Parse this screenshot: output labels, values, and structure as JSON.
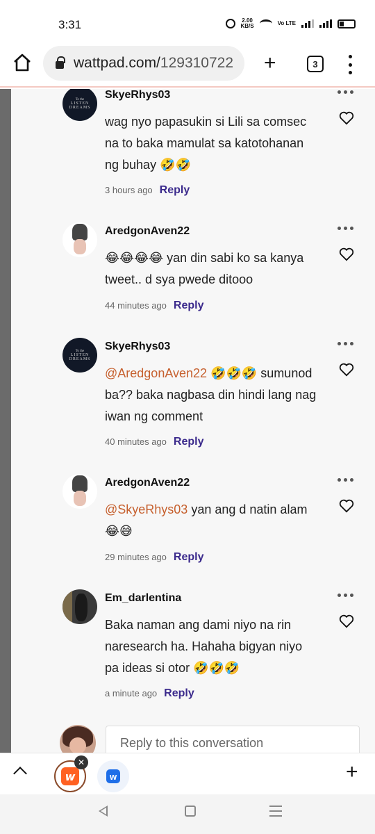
{
  "status_bar": {
    "time": "3:31",
    "net_speed": "2.00",
    "net_unit": "KB/S",
    "volte": "Vo LTE"
  },
  "browser": {
    "url_domain": "wattpad.com/",
    "url_path": "129310722",
    "tab_count": "3"
  },
  "comments": [
    {
      "username": "SkyeRhys03",
      "mention": "",
      "text_lines": [
        "wag nyo papasukin si Lili sa comsec",
        "na to baka mamulat sa katotohanan",
        "ng buhay 🤣🤣"
      ],
      "time": "3 hours ago",
      "reply": "Reply",
      "avatar": "book-cover"
    },
    {
      "username": "AredgonAven22",
      "mention": "",
      "text_lines": [
        "😂😂😂😂 yan din sabi ko sa kanya",
        "tweet.. d sya pwede ditooo"
      ],
      "time": "44 minutes ago",
      "reply": "Reply",
      "avatar": "girl-portrait"
    },
    {
      "username": "SkyeRhys03",
      "mention": "@AredgonAven22",
      "text_lines": [
        " 🤣🤣🤣 sumunod",
        "ba?? baka nagbasa din hindi lang nag",
        "iwan ng comment"
      ],
      "time": "40 minutes ago",
      "reply": "Reply",
      "avatar": "book-cover"
    },
    {
      "username": "AredgonAven22",
      "mention": "@SkyeRhys03",
      "text_lines": [
        "  yan ang d natin alam",
        "😂😅"
      ],
      "time": "29 minutes ago",
      "reply": "Reply",
      "avatar": "girl-portrait"
    },
    {
      "username": "Em_darlentina",
      "mention": "",
      "text_lines": [
        "Baka naman ang dami niyo na rin",
        "naresearch ha. Hahaha bigyan niyo",
        "pa ideas si otor 🤣🤣🤣"
      ],
      "time": "a minute ago",
      "reply": "Reply",
      "avatar": "dark-photo"
    }
  ],
  "reply_box": {
    "placeholder": "Reply to this conversation"
  },
  "book_avatar_text": {
    "line1": "To the",
    "line2": "LISTEN",
    "line3": "DREAMS"
  },
  "colors": {
    "reply_link": "#3b2a8c",
    "mention": "#c6602e",
    "wattpad_orange": "#ff6122"
  }
}
